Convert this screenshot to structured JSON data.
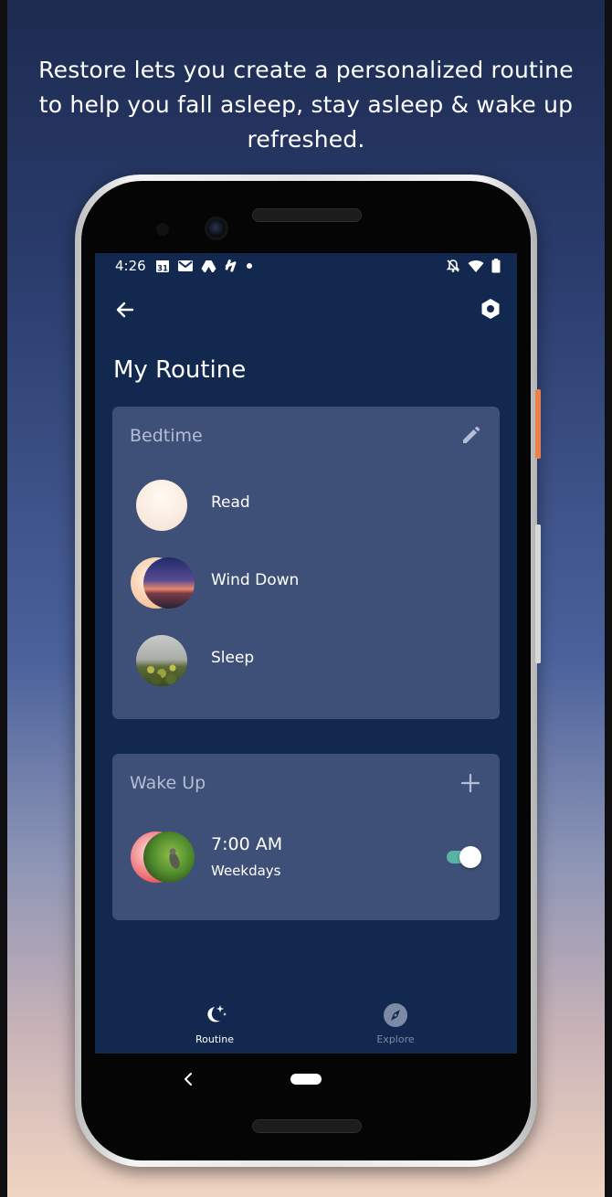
{
  "headline": "Restore lets you create a personalized routine to help you fall asleep, stay asleep & wake up refreshed.",
  "status_bar": {
    "time": "4:26",
    "calendar_day": "31"
  },
  "page": {
    "title": "My Routine"
  },
  "bedtime": {
    "title": "Bedtime",
    "items": [
      {
        "label": "Read",
        "icon": "read-thumb"
      },
      {
        "label": "Wind Down",
        "icon": "wind-down-thumb"
      },
      {
        "label": "Sleep",
        "icon": "sleep-thumb"
      }
    ]
  },
  "wake_up": {
    "title": "Wake Up",
    "alarm": {
      "time": "7:00 AM",
      "days": "Weekdays",
      "enabled": true
    }
  },
  "bottom_nav": {
    "items": [
      {
        "label": "Routine",
        "icon": "moon-stars-icon",
        "active": true
      },
      {
        "label": "Explore",
        "icon": "compass-icon",
        "active": false
      }
    ]
  },
  "colors": {
    "screen_bg": "#13284f",
    "card_bg": "#3f5078",
    "card_title": "#b4bdd4",
    "toggle_on": "#59b3a4",
    "nav_inactive": "#7d8aa6"
  }
}
